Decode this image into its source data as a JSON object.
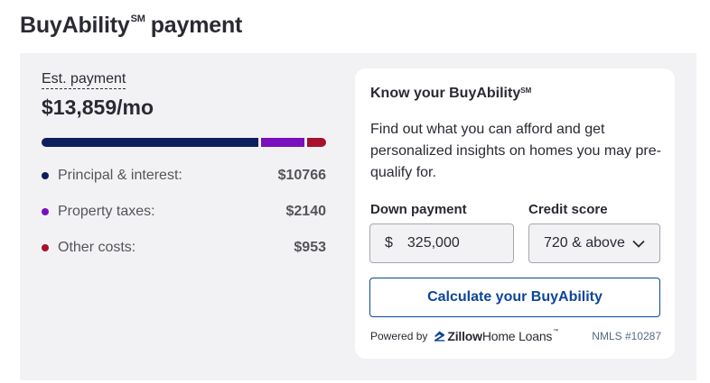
{
  "header": {
    "title": "BuyAbility",
    "title_mark": "SM",
    "title_suffix": "payment"
  },
  "estimate": {
    "label": "Est. payment",
    "value": "$13,859/mo"
  },
  "breakdown": {
    "bar_fractions": [
      0.777,
      0.154,
      0.069
    ],
    "items": [
      {
        "label": "Principal & interest:",
        "value": "$10766",
        "color": "#0d1f5e"
      },
      {
        "label": "Property taxes:",
        "value": "$2140",
        "color": "#7a0fbd"
      },
      {
        "label": "Other costs:",
        "value": "$953",
        "color": "#a8102c"
      }
    ]
  },
  "card": {
    "title": "Know your BuyAbility",
    "title_mark": "SM",
    "description": "Find out what you can afford and get personalized insights on homes you may pre-qualify for.",
    "down_payment": {
      "label": "Down payment",
      "currency": "$",
      "value": "325,000"
    },
    "credit_score": {
      "label": "Credit score",
      "value": "720 & above"
    },
    "button_label": "Calculate your BuyAbility",
    "powered_by": "Powered by",
    "logo_text_bold": "Zillow",
    "logo_text": "Home Loans",
    "logo_tm": "™",
    "nmls": "NMLS #10287"
  },
  "colors": {
    "accent": "#0d4599",
    "panel_bg": "#f2f2f5",
    "text": "#2a2a33"
  },
  "icons": {
    "credit_dropdown": "chevron-down-icon",
    "logo_mark": "zillow-z-icon"
  }
}
